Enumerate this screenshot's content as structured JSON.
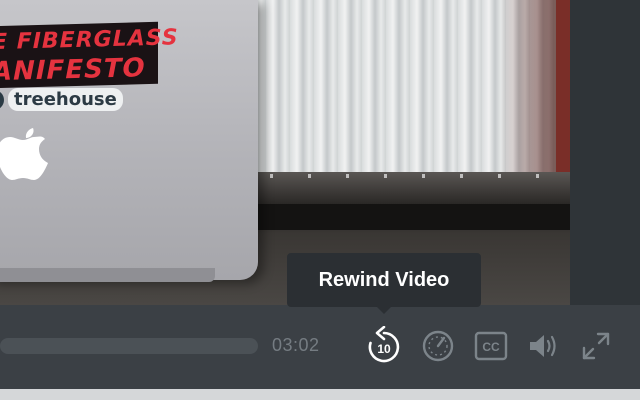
{
  "video": {
    "sticker_line1": "E FIBERGLASS",
    "sticker_line2": "ANIFESTO",
    "brand_text": "treehouse"
  },
  "player": {
    "current_time": "03:02",
    "tooltip": "Rewind Video",
    "rewind_seconds": "10",
    "cc_label": "CC",
    "controls": [
      {
        "name": "rewind-10-icon",
        "label": "Rewind Video"
      },
      {
        "name": "playback-speed-icon"
      },
      {
        "name": "closed-captions-icon"
      },
      {
        "name": "volume-icon"
      },
      {
        "name": "fullscreen-icon"
      }
    ],
    "colors": {
      "control_bar": "#3b4045",
      "icon": "#7c848a",
      "icon_active": "#ffffff",
      "tooltip_bg": "#2b2f33",
      "track": "#4b5156"
    }
  }
}
